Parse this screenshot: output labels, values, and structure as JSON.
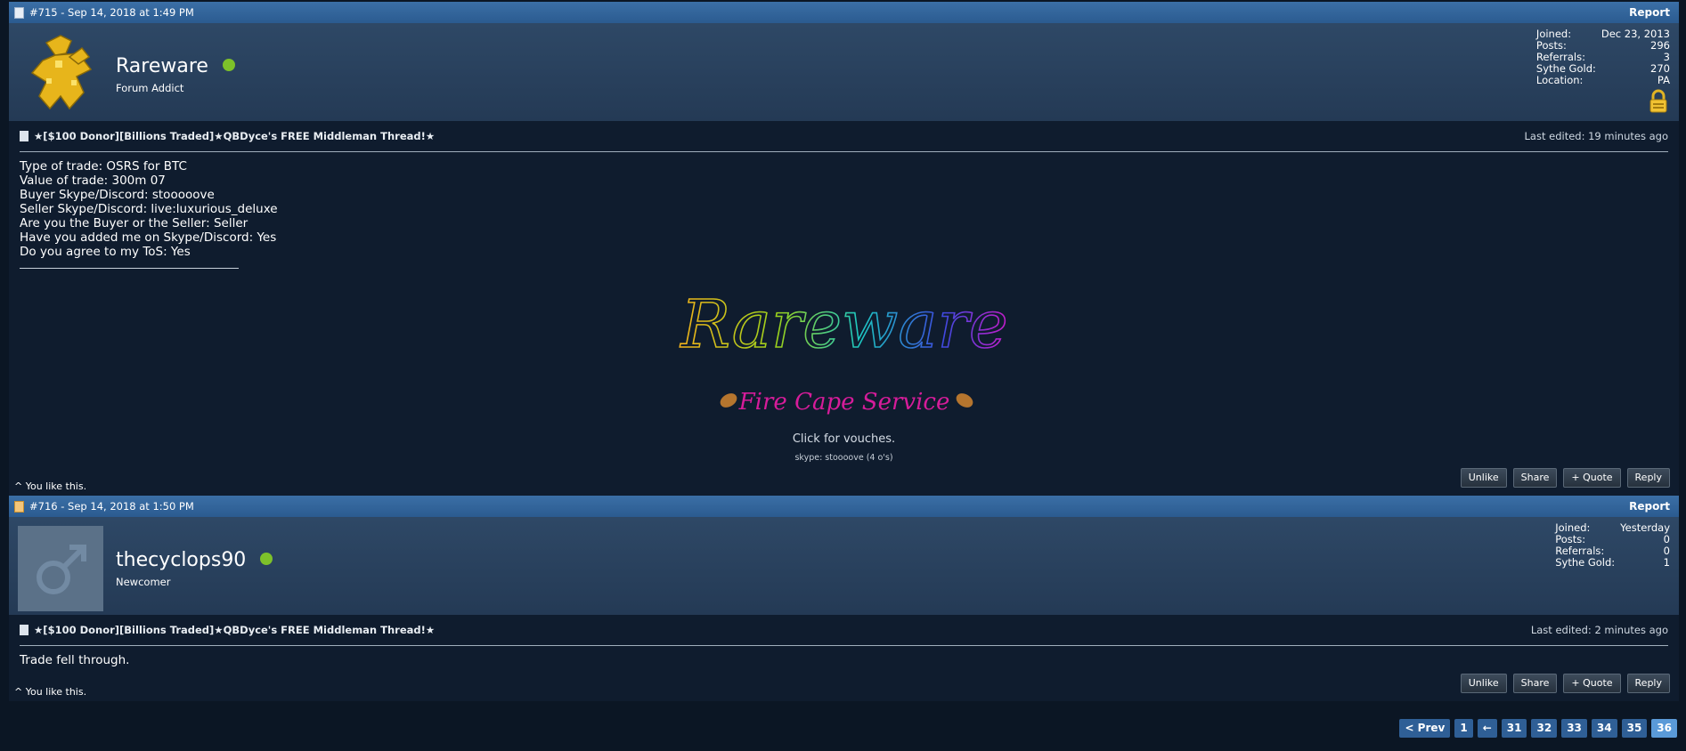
{
  "posts": [
    {
      "header": {
        "number_date": "#715 - Sep 14, 2018 at 1:49 PM",
        "report": "Report"
      },
      "user": {
        "name": "Rareware",
        "title": "Forum Addict",
        "stats": [
          {
            "label": "Joined:",
            "value": "Dec 23, 2013"
          },
          {
            "label": "Posts:",
            "value": "296"
          },
          {
            "label": "Referrals:",
            "value": "3"
          },
          {
            "label": "Sythe Gold:",
            "value": "270"
          },
          {
            "label": "Location:",
            "value": "PA"
          }
        ]
      },
      "thread_title": "★[$100 Donor][Billions Traded]★QBDyce's FREE Middleman Thread!★",
      "last_edited": "Last edited: 19 minutes ago",
      "lines": [
        "Type of trade: OSRS for BTC",
        "Value of trade: 300m 07",
        "Buyer Skype/Discord: stooooove",
        "Seller Skype/Discord: live:luxurious_deluxe",
        "Are you the Buyer or the Seller: Seller",
        "Have you added me on Skype/Discord: Yes",
        "Do you agree to my ToS: Yes"
      ],
      "signature": {
        "name_script": "Rareware",
        "service_script": "Fire Cape Service",
        "vouches": "Click for vouches.",
        "skype": "skype: stoooove (4 o's)"
      },
      "like_text": "^ You like this.",
      "buttons": {
        "unlike": "Unlike",
        "share": "Share",
        "quote": "+ Quote",
        "reply": "Reply"
      }
    },
    {
      "header": {
        "number_date": "#716 - Sep 14, 2018 at 1:50 PM",
        "report": "Report"
      },
      "user": {
        "name": "thecyclops90",
        "title": "Newcomer",
        "stats": [
          {
            "label": "Joined:",
            "value": "Yesterday"
          },
          {
            "label": "Posts:",
            "value": "0"
          },
          {
            "label": "Referrals:",
            "value": "0"
          },
          {
            "label": "Sythe Gold:",
            "value": "1"
          }
        ]
      },
      "thread_title": "★[$100 Donor][Billions Traded]★QBDyce's FREE Middleman Thread!★",
      "last_edited": "Last edited: 2 minutes ago",
      "lines": [
        "Trade fell through."
      ],
      "like_text": "^ You like this.",
      "buttons": {
        "unlike": "Unlike",
        "share": "Share",
        "quote": "+ Quote",
        "reply": "Reply"
      }
    }
  ],
  "pagination": [
    "< Prev",
    "1",
    "←",
    "31",
    "32",
    "33",
    "34",
    "35",
    "36"
  ],
  "pagination_current": "36",
  "colors": {
    "header_blue": "#2b5b90",
    "online_green": "#7dc12a",
    "page_bg": "#0b1624"
  }
}
